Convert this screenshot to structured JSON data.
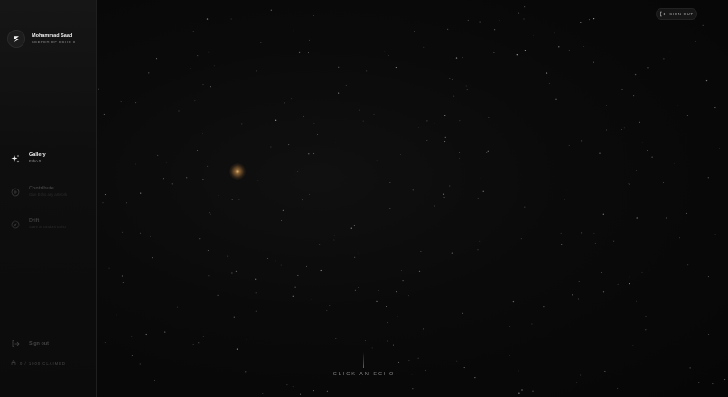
{
  "profile": {
    "name": "Mohammad Saad",
    "role": "KEEPER OF ECHO 0"
  },
  "nav": {
    "items": [
      {
        "label": "Gallery",
        "sub": "Echo 0",
        "icon": "sparkles-icon",
        "active": true
      },
      {
        "label": "Contribute",
        "sub": "Give Echo any artwork",
        "icon": "plus-circle-icon",
        "active": false
      },
      {
        "label": "Drift",
        "sub": "Stare at random Echo",
        "icon": "compass-icon",
        "active": false
      }
    ]
  },
  "sidebar_footer": {
    "signout_label": "Sign out",
    "claimed_label": "0 / 1000 CLAIMED"
  },
  "header": {
    "signout_label": "SIGN OUT"
  },
  "canvas": {
    "hint": "CLICK AN ECHO"
  },
  "colors": {
    "background": "#070707",
    "sidebar": "#0e0e0e",
    "echo_glow": "#ffcd82"
  }
}
